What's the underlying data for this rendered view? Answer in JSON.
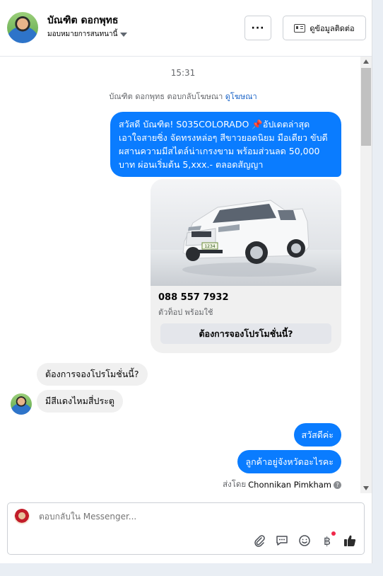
{
  "header": {
    "name": "บัณฑิต ดอกพุทธ",
    "assign_label": "มอบหมายการสนทนานี้",
    "more_label": "···",
    "contact_label": "ดูข้อมูลติดต่อ"
  },
  "thread": {
    "time": "15:31",
    "reply_note_text": "บัณฑิต ดอกพุทธ ตอบกลับโฆษณา",
    "reply_note_link": "ดูโฆษณา",
    "ad_message": "สวัสดี บัณฑิต! S035COLORADO 📌อัปเดตล่าสุด เอาใจสายซิ่ง จัดทรงหล่อๆ สีขาวยอดนิยม มือเดียว ขับดี ผสานความมีสไตล์น่าเกรงขาม พร้อมส่วนลด 50,000 บาท ผ่อนเริ่มต้น 5,xxx.- ตลอดสัญญา",
    "card": {
      "title": "088 557 7932",
      "subtitle": "ตัวท็อป พร้อมใช้",
      "button": "ต้องการจองโปรโมชั่นนี้?",
      "plate": "1234"
    },
    "incoming": [
      "ต้องการจองโปรโมชั่นนี้?",
      "มีสีแดงไหมสี่ประตู"
    ],
    "outgoing": [
      "สวัสดีค่ะ",
      "ลูกค้าอยู่จังหวัดอะไรคะ"
    ],
    "sent_by_prefix": "ส่งโดย",
    "sent_by_name": "Chonnikan Pimkham"
  },
  "composer": {
    "placeholder": "ตอบกลับใน Messenger...",
    "tools": [
      "attach-icon",
      "chat-icon",
      "emoji-icon",
      "baht-icon",
      "like-icon"
    ]
  },
  "colors": {
    "outgoing_bubble": "#0a7cff",
    "incoming_bubble": "#f0f0f0",
    "link": "#1a64c8"
  }
}
